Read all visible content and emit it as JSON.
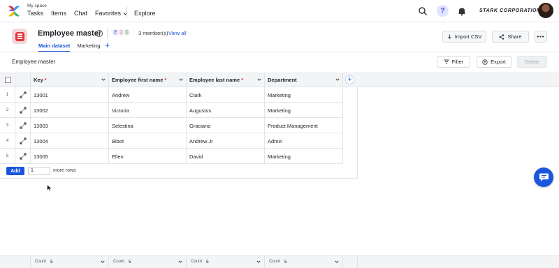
{
  "nav": {
    "workspace": "My space",
    "items": [
      "Tasks",
      "Items",
      "Chat"
    ],
    "favorites": "Favorites",
    "explore": "Explore",
    "help": "?",
    "brand": "STARK CORPORATION"
  },
  "header": {
    "title": "Employee master",
    "info": "i",
    "members": [
      "E",
      "J",
      "C"
    ],
    "members_text": "3 member(s)",
    "view_all": "View all",
    "tabs": [
      "Main dataset",
      "Marketing"
    ],
    "tab_add": "+",
    "import_label": "Import CSV",
    "share_label": "Share",
    "more_label": "•••"
  },
  "toolbar": {
    "title": "Employee master",
    "filter_label": "Filter",
    "export_label": "Export",
    "delete_label": "Delete"
  },
  "table": {
    "columns": [
      {
        "label": "Key",
        "required": "*"
      },
      {
        "label": "Employee first name",
        "required": "*"
      },
      {
        "label": "Employee last name",
        "required": "*"
      },
      {
        "label": "Department",
        "required": ""
      }
    ],
    "add_column": "+",
    "rows": [
      {
        "n": "1",
        "key": "13001",
        "first": "Andrew",
        "last": "Clark",
        "dept": "Marketing"
      },
      {
        "n": "2",
        "key": "13002",
        "first": "Victoria",
        "last": "Augustus",
        "dept": "Marketing"
      },
      {
        "n": "3",
        "key": "13003",
        "first": "Selestina",
        "last": "Graciano",
        "dept": "Product Management"
      },
      {
        "n": "4",
        "key": "13004",
        "first": "Bibot",
        "last": "Andrew Jr",
        "dept": "Admin"
      },
      {
        "n": "5",
        "key": "13005",
        "first": "Ellen",
        "last": "David",
        "dept": "Marketing"
      }
    ],
    "add_label": "Add",
    "add_count": "1",
    "more_rows": "more rows"
  },
  "footer": {
    "count_label": "Count",
    "counts": [
      "5",
      "5",
      "5",
      "5"
    ]
  },
  "colors": {
    "accent": "#1a56db",
    "required": "#e0343a"
  }
}
